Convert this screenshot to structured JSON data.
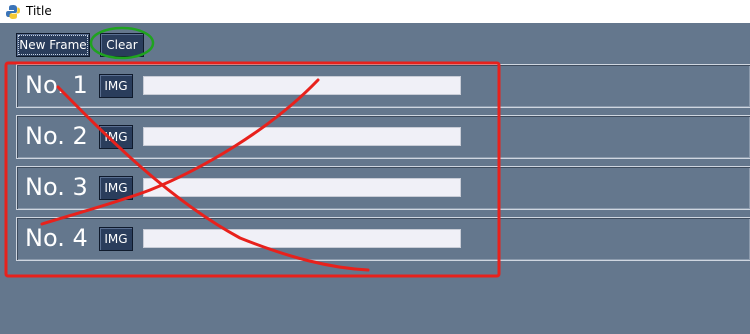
{
  "window": {
    "title": "Title",
    "app_icon": "python-icon"
  },
  "toolbar": {
    "new_frame_label": "New Frame",
    "clear_label": "Clear"
  },
  "frames": [
    {
      "label": "No. 1",
      "img_label": "IMG",
      "entry_value": ""
    },
    {
      "label": "No. 2",
      "img_label": "IMG",
      "entry_value": ""
    },
    {
      "label": "No. 3",
      "img_label": "IMG",
      "entry_value": ""
    },
    {
      "label": "No. 4",
      "img_label": "IMG",
      "entry_value": ""
    }
  ],
  "annotations": {
    "red_color": "#e8211c",
    "green_color": "#1fa31f",
    "marks": [
      "red-box",
      "red-cross",
      "green-circle"
    ]
  },
  "colors": {
    "background": "#64778d",
    "button": "#2a3d5c",
    "entry": "#f0f0f7"
  }
}
